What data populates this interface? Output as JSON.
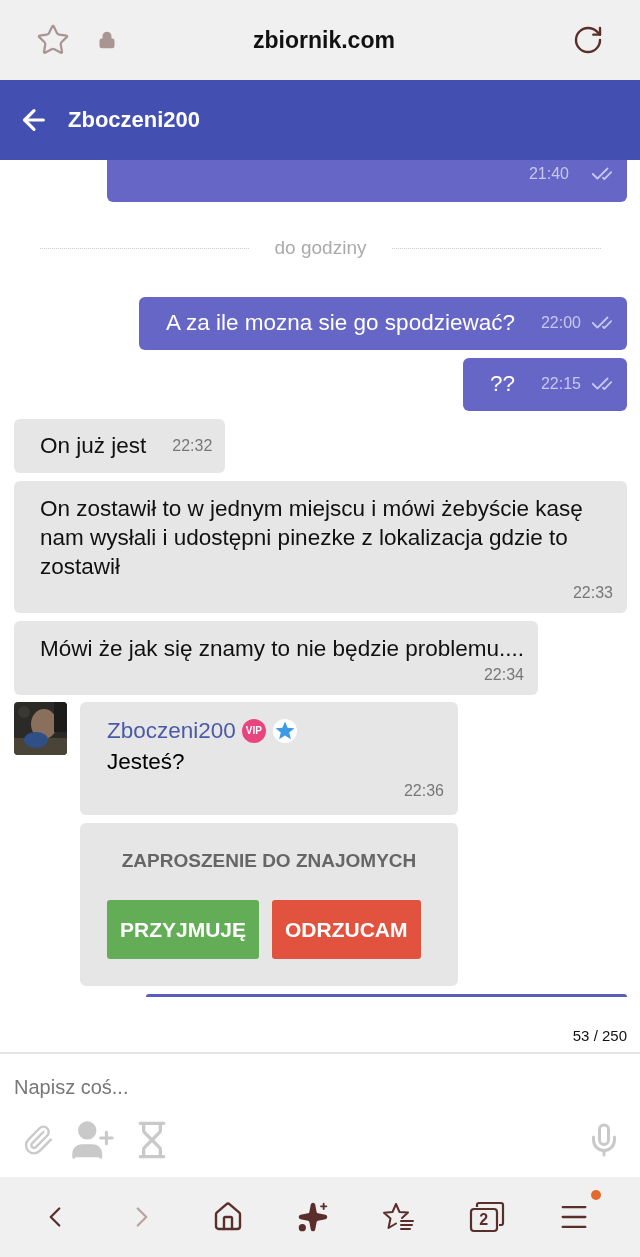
{
  "browser": {
    "url": "zbiornik.com"
  },
  "header": {
    "title": "Zboczeni200"
  },
  "messages": [
    {
      "kind": "sent_clipped",
      "time": "21:40"
    },
    {
      "kind": "divider",
      "text": "do godziny"
    },
    {
      "kind": "sent",
      "text": "A za ile mozna sie go spodziewać?",
      "time": "22:00"
    },
    {
      "kind": "sent",
      "text": "??",
      "time": "22:15"
    },
    {
      "kind": "received",
      "text": "On już jest",
      "time": "22:32"
    },
    {
      "kind": "received_block",
      "text": "On zostawił to w jednym miejscu i mówi żebyście kasę nam wysłali i udostępni pinezke z lokalizacja gdzie to zostawił",
      "time": "22:33"
    },
    {
      "kind": "received_block",
      "text": "Mówi że jak się znamy to nie będzie problemu....",
      "time": "22:34"
    },
    {
      "kind": "received_named",
      "author": "Zboczeni200",
      "badge": "VIP",
      "text": "Jesteś?",
      "time": "22:36"
    },
    {
      "kind": "invite",
      "title": "ZAPROSZENIE DO ZNAJOMYCH",
      "accept": "PRZYJMUJĘ",
      "reject": "ODRZUCAM"
    },
    {
      "kind": "sent_edge"
    }
  ],
  "counter": "53 / 250",
  "composer": {
    "placeholder": "Napisz coś..."
  },
  "nav": [
    {
      "kind": "back",
      "disabled": false
    },
    {
      "kind": "forward",
      "disabled": true
    },
    {
      "kind": "home",
      "disabled": false
    },
    {
      "kind": "sparkles",
      "disabled": false
    },
    {
      "kind": "bookmarks",
      "disabled": false
    },
    {
      "kind": "tabs",
      "disabled": false,
      "count": "2"
    },
    {
      "kind": "menu",
      "disabled": false,
      "notification": true
    }
  ]
}
